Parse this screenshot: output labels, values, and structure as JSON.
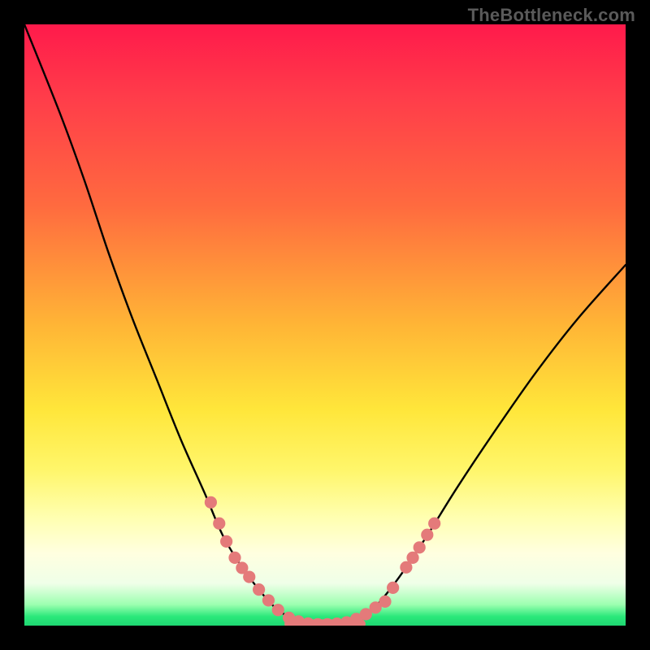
{
  "watermark": "TheBottleneck.com",
  "chart_data": {
    "type": "line",
    "title": "",
    "xlabel": "",
    "ylabel": "",
    "xlim": [
      0,
      100
    ],
    "ylim": [
      0,
      100
    ],
    "series": [
      {
        "name": "curve",
        "x": [
          0,
          6,
          10,
          14,
          18,
          22,
          26,
          30,
          33,
          36,
          39,
          41.5,
          44,
          46,
          48,
          50,
          52,
          54,
          56,
          58,
          60,
          63,
          67,
          72,
          78,
          85,
          92,
          100
        ],
        "y": [
          100,
          85,
          74,
          62,
          51,
          41,
          31,
          22,
          15,
          10,
          6,
          3.2,
          1.4,
          0.6,
          0.3,
          0.2,
          0.3,
          0.6,
          1.4,
          2.8,
          5,
          9,
          15,
          23,
          32,
          42,
          51,
          60
        ]
      }
    ],
    "markers": [
      {
        "x": 31.0,
        "y": 20.5
      },
      {
        "x": 32.4,
        "y": 17.0
      },
      {
        "x": 33.6,
        "y": 14.0
      },
      {
        "x": 35.0,
        "y": 11.3
      },
      {
        "x": 36.2,
        "y": 9.6
      },
      {
        "x": 37.4,
        "y": 8.1
      },
      {
        "x": 39.0,
        "y": 6.0
      },
      {
        "x": 40.6,
        "y": 4.2
      },
      {
        "x": 42.2,
        "y": 2.6
      },
      {
        "x": 44.0,
        "y": 1.3
      },
      {
        "x": 45.6,
        "y": 0.7
      },
      {
        "x": 47.2,
        "y": 0.35
      },
      {
        "x": 48.8,
        "y": 0.22
      },
      {
        "x": 50.4,
        "y": 0.22
      },
      {
        "x": 52.0,
        "y": 0.32
      },
      {
        "x": 53.6,
        "y": 0.55
      },
      {
        "x": 55.2,
        "y": 1.1
      },
      {
        "x": 56.8,
        "y": 1.9
      },
      {
        "x": 58.4,
        "y": 3.0
      },
      {
        "x": 60.0,
        "y": 4.0
      },
      {
        "x": 61.3,
        "y": 6.3
      },
      {
        "x": 63.5,
        "y": 9.7
      },
      {
        "x": 64.6,
        "y": 11.3
      },
      {
        "x": 65.7,
        "y": 13.0
      },
      {
        "x": 67.0,
        "y": 15.1
      },
      {
        "x": 68.2,
        "y": 17.0
      }
    ],
    "flat_segment": {
      "x0": 44,
      "x1": 56,
      "y": 0.3
    },
    "colors": {
      "curve": "#000000",
      "marker_fill": "#e47a7a",
      "marker_stroke": "#c95f62",
      "flat_stroke": "#e47a7a"
    }
  }
}
